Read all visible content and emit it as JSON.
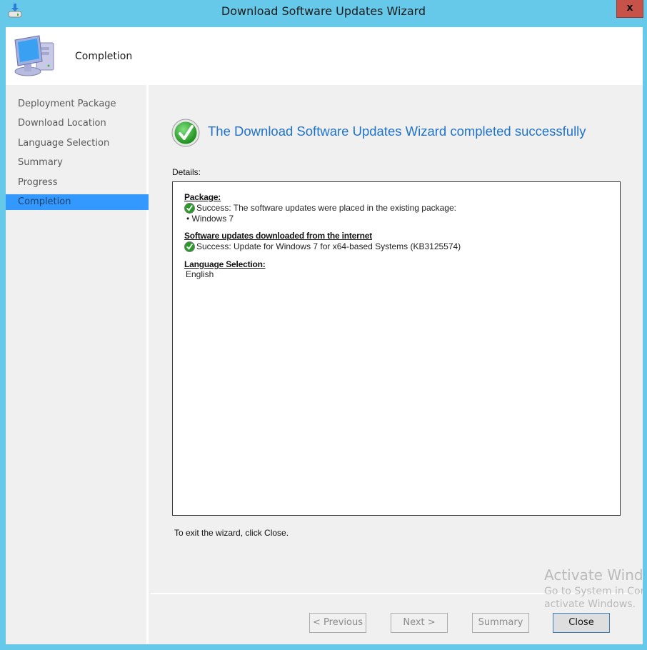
{
  "window": {
    "title": "Download Software Updates Wizard",
    "close_glyph": "x",
    "app_icon": "download-drive-icon"
  },
  "header": {
    "step_title": "Completion",
    "icon": "computer-icon"
  },
  "sidebar": {
    "items": [
      {
        "label": "Deployment Package",
        "active": false
      },
      {
        "label": "Download Location",
        "active": false
      },
      {
        "label": "Language Selection",
        "active": false
      },
      {
        "label": "Summary",
        "active": false
      },
      {
        "label": "Progress",
        "active": false
      },
      {
        "label": "Completion",
        "active": true
      }
    ]
  },
  "main": {
    "heading": "The Download Software Updates Wizard completed successfully",
    "details_label": "Details:",
    "details": {
      "package_heading": "Package:",
      "package_status": "Success: The software updates were placed in the existing package:",
      "package_item": "• Windows 7",
      "downloads_heading": "Software updates downloaded from the internet",
      "downloads_status": "Success: Update for Windows 7 for x64-based Systems (KB3125574)",
      "language_heading": "Language Selection:",
      "language_value": "English"
    },
    "exit_text": "To exit the wizard, click Close."
  },
  "buttons": {
    "previous": "< Previous",
    "next": "Next >",
    "summary": "Summary",
    "close": "Close"
  },
  "watermark": {
    "line1": "Activate Windows",
    "line2": "Go to System in Control Panel to",
    "line3": "activate Windows."
  },
  "colors": {
    "frame": "#66c9e9",
    "accent_heading": "#1f73c9",
    "sidebar_active": "#3399ff",
    "close_button": "#c7524a"
  }
}
